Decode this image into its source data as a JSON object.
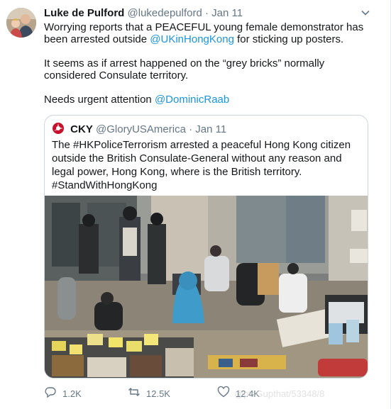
{
  "author": {
    "name": "Luke de Pulford",
    "handle": "@lukedepulford",
    "separator": "·",
    "date": "Jan 11"
  },
  "tweet": {
    "line1_a": "Worrying reports that a PEACEFUL young female demonstrator has been arrested outside ",
    "mention1": "@UKinHongKong",
    "line1_b": " for sticking up posters.",
    "line2": "It seems as if arrest happened on the “grey bricks” normally considered Consulate territory.",
    "line3_a": "Needs urgent attention ",
    "mention2": "@DominicRaab"
  },
  "quoted": {
    "name": "CKY",
    "handle": "@GloryUSAmerica",
    "separator": "·",
    "date": "Jan 11",
    "text_a": "The ",
    "hashtag1": "#HKPoliceTerrorism",
    "text_b": " arrested a peaceful Hong Kong citizen outside the British Consulate-General without any reason and legal power, Hong Kong, where is the British territory.",
    "hashtag2": "#StandWithHongKong",
    "photo_icon": "street-arrest-photo"
  },
  "actions": {
    "reply_count": "1.2K",
    "retweet_count": "12.5K",
    "like_count": "12.4K",
    "reply_icon": "reply-icon",
    "retweet_icon": "retweet-icon",
    "like_icon": "heart-icon"
  },
  "watermark": "@ptsGupthat/53348/8",
  "colors": {
    "link": "#1b95e0",
    "secondary": "#657786",
    "border": "#ccd6dd"
  }
}
